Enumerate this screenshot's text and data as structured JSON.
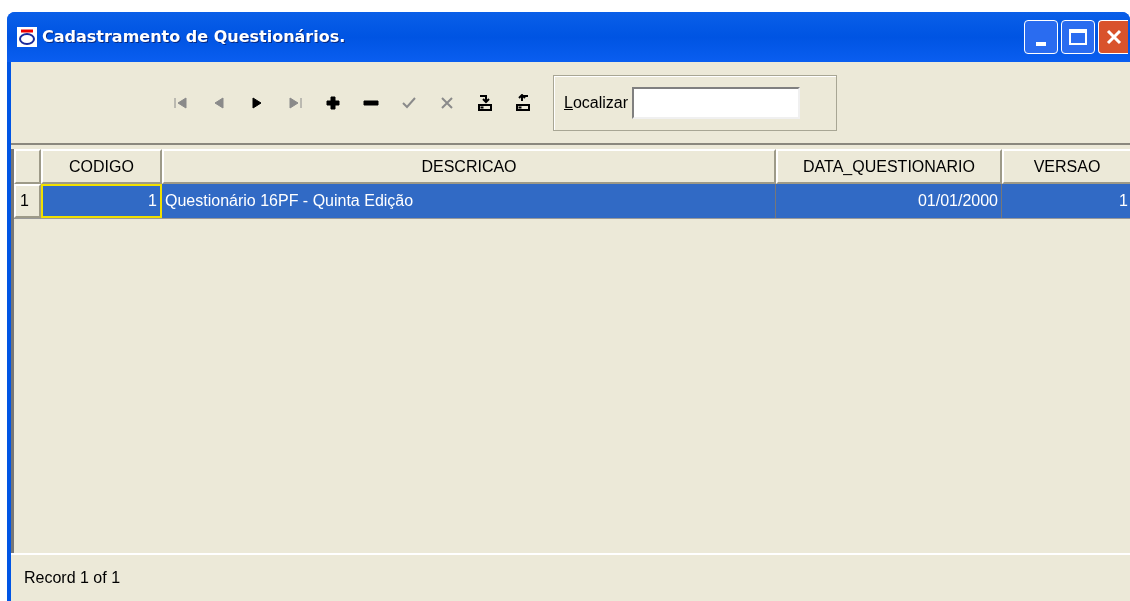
{
  "window": {
    "title": "Cadastramento de Questionários."
  },
  "toolbar": {
    "buttons": [
      {
        "kind": "first",
        "disabled": true
      },
      {
        "kind": "prior",
        "disabled": true
      },
      {
        "kind": "next",
        "disabled": false
      },
      {
        "kind": "last",
        "disabled": true
      },
      {
        "kind": "insert",
        "disabled": false
      },
      {
        "kind": "delete",
        "disabled": false
      },
      {
        "kind": "post",
        "disabled": true
      },
      {
        "kind": "cancel",
        "disabled": true
      },
      {
        "kind": "save",
        "disabled": false
      },
      {
        "kind": "undo",
        "disabled": false
      }
    ],
    "search": {
      "label": "Localizar"
    }
  },
  "table": {
    "columns": [
      "CODIGO",
      "DESCRICAO",
      "DATA_QUESTIONARIO",
      "VERSAO"
    ],
    "rows": [
      {
        "indicator": "1",
        "selected": true,
        "cells": [
          {
            "text": "1",
            "focused": true
          },
          {
            "text": "Questionário 16PF - Quinta Edição",
            "focused": false
          },
          {
            "text": "01/01/2000",
            "focused": false
          },
          {
            "text": "1",
            "focused": false
          }
        ]
      }
    ]
  },
  "status_bar": "Record 1 of 1"
}
